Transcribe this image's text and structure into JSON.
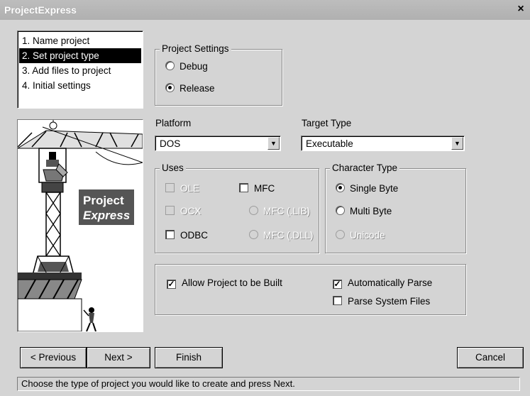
{
  "window": {
    "title": "ProjectExpress",
    "close_glyph": "×"
  },
  "steps": [
    "1. Name project",
    "2. Set project type",
    "3. Add files to project",
    "4. Initial settings"
  ],
  "selected_step": 1,
  "art": {
    "text_line1": "Project",
    "text_line2": "Express"
  },
  "project_settings": {
    "legend": "Project Settings",
    "debug": "Debug",
    "release": "Release",
    "selected": "Release"
  },
  "platform": {
    "label": "Platform",
    "value": "DOS"
  },
  "target_type": {
    "label": "Target Type",
    "value": "Executable"
  },
  "uses": {
    "legend": "Uses",
    "ole": "OLE",
    "mfc": "MFC",
    "ocx": "OCX",
    "mfc_lib": "MFC (.LIB)",
    "odbc": "ODBC",
    "mfc_dll": "MFC (.DLL)"
  },
  "character_type": {
    "legend": "Character Type",
    "single": "Single Byte",
    "multi": "Multi Byte",
    "unicode": "Unicode",
    "selected": "Single Byte"
  },
  "options": {
    "allow_build": "Allow Project to be Built",
    "allow_build_checked": true,
    "auto_parse": "Automatically Parse",
    "auto_parse_checked": true,
    "parse_system": "Parse System Files",
    "parse_system_checked": false
  },
  "buttons": {
    "previous": "< Previous",
    "next": "Next >",
    "finish": "Finish",
    "cancel": "Cancel"
  },
  "status": "Choose the type of project you would like to create and press Next."
}
